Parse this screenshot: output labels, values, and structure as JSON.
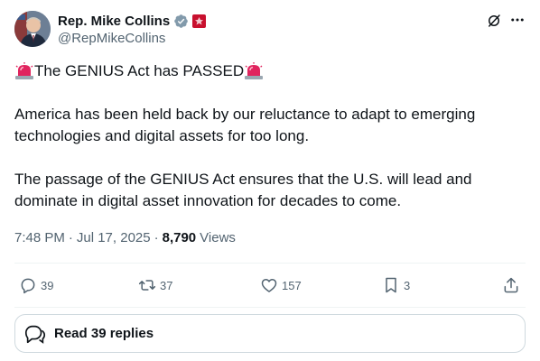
{
  "author": {
    "display_name": "Rep. Mike Collins",
    "handle": "@RepMikeCollins",
    "verified_badge_color": "#829aab",
    "affiliation_badge_color": "#c8102e"
  },
  "tweet": {
    "headline_prefix_emoji": "siren-emoji",
    "headline": "The GENIUS Act has PASSED",
    "headline_suffix_emoji": "siren-emoji",
    "paragraph_1": "America has been held back by our reluctance to adapt to emerging technologies and digital assets for too long.",
    "paragraph_2": "The passage of the GENIUS Act ensures that the U.S. will lead and dominate in digital asset innovation for decades to come."
  },
  "meta": {
    "time": "7:48 PM",
    "separator": "·",
    "date": "Jul 17, 2025",
    "views_count": "8,790",
    "views_label": "Views"
  },
  "actions": {
    "replies": "39",
    "reposts": "37",
    "likes": "157",
    "bookmarks": "3"
  },
  "read_replies": {
    "label": "Read 39 replies"
  },
  "colors": {
    "text_primary": "#0f1419",
    "text_secondary": "#536471",
    "border": "#cfd9de",
    "siren_red": "#e0245e"
  }
}
